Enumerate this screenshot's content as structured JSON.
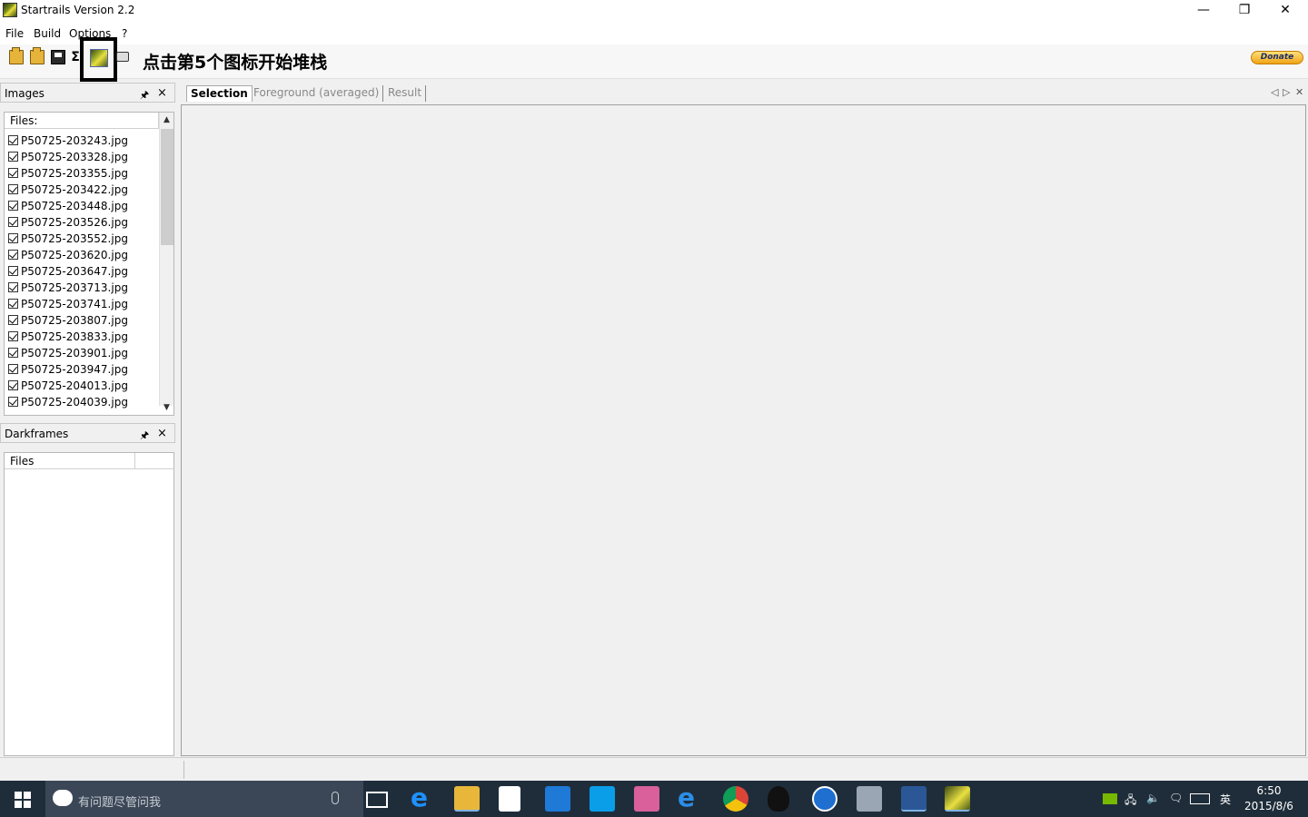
{
  "window": {
    "title": "Startrails Version 2.2",
    "minimize": "—",
    "restore": "❐",
    "close": "✕"
  },
  "menu": {
    "items": [
      "File",
      "Build",
      "Options",
      "?"
    ]
  },
  "toolbar": {
    "instruction": "点击第5个图标开始堆栈",
    "sigma": "Σ",
    "donate_label": "Donate"
  },
  "images_pane": {
    "title": "Images",
    "pin": "🖈",
    "close": "×",
    "column_header": "Files:",
    "files": [
      "P50725-203243.jpg",
      "P50725-203328.jpg",
      "P50725-203355.jpg",
      "P50725-203422.jpg",
      "P50725-203448.jpg",
      "P50725-203526.jpg",
      "P50725-203552.jpg",
      "P50725-203620.jpg",
      "P50725-203647.jpg",
      "P50725-203713.jpg",
      "P50725-203741.jpg",
      "P50725-203807.jpg",
      "P50725-203833.jpg",
      "P50725-203901.jpg",
      "P50725-203947.jpg",
      "P50725-204013.jpg",
      "P50725-204039.jpg"
    ]
  },
  "darkframes_pane": {
    "title": "Darkframes",
    "pin": "🖈",
    "close": "×",
    "column_header": "Files"
  },
  "tabs": {
    "items": [
      "Selection",
      "Foreground (averaged)",
      "Result"
    ],
    "active": "Selection",
    "nav_left": "◁",
    "nav_right": "▷",
    "nav_close": "✕"
  },
  "taskbar": {
    "search_placeholder": "有问题尽管问我",
    "tray_lang": "英",
    "clock_time": "6:50",
    "clock_date": "2015/8/6"
  }
}
